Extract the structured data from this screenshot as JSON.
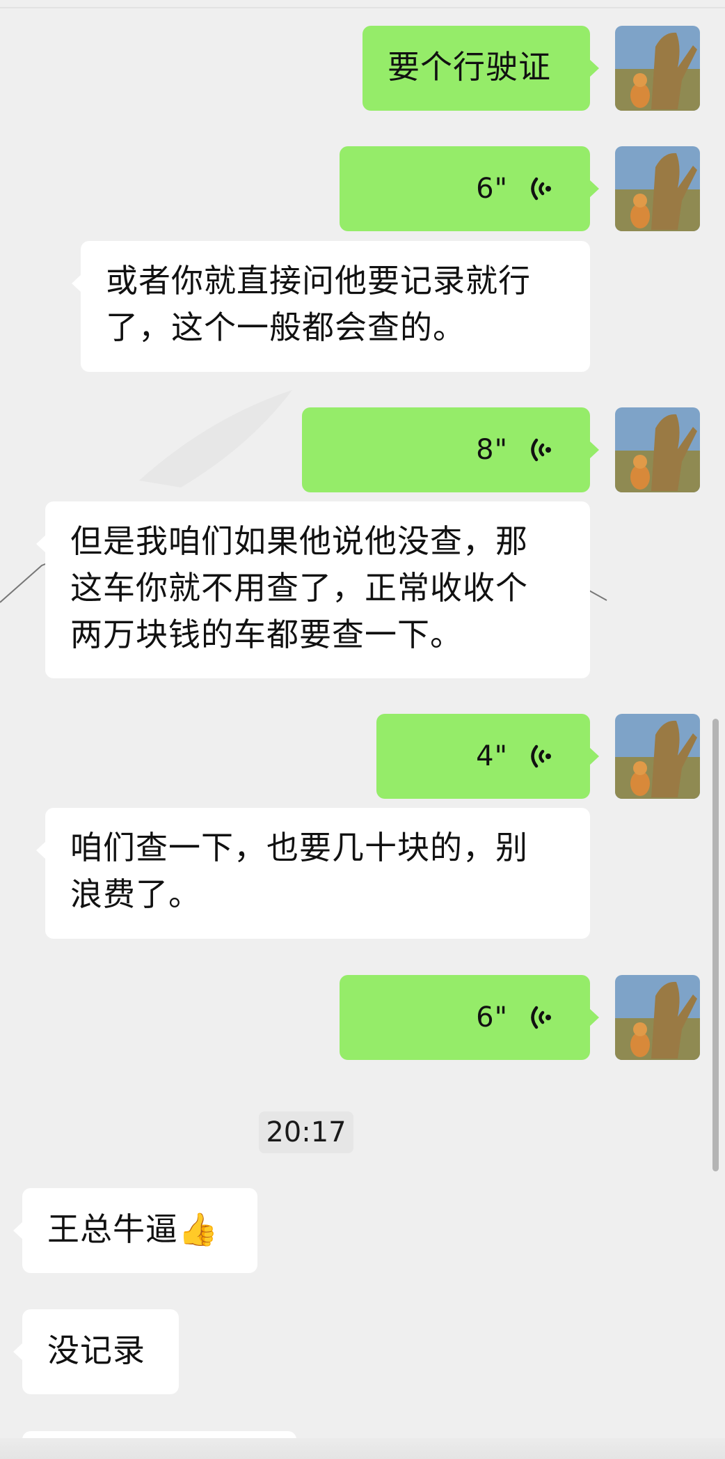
{
  "messages": [
    {
      "kind": "text",
      "side": "sent",
      "text": "要个行驶证"
    },
    {
      "kind": "voice",
      "side": "sent",
      "duration": "6\""
    },
    {
      "kind": "text",
      "side": "received",
      "lines": [
        "或者你就直接问他要记录就行",
        "了，这个一般都会查的。"
      ]
    },
    {
      "kind": "voice",
      "side": "sent",
      "duration": "8\""
    },
    {
      "kind": "text",
      "side": "received",
      "lines": [
        "但是我咱们如果他说他没查，那",
        "这车你就不用查了，正常收收个",
        "两万块钱的车都要查一下。"
      ]
    },
    {
      "kind": "voice",
      "side": "sent",
      "duration": "4\""
    },
    {
      "kind": "text",
      "side": "received",
      "lines": [
        "咱们查一下，也要几十块的，别",
        "浪费了。"
      ]
    },
    {
      "kind": "voice",
      "side": "sent",
      "duration": "6\""
    },
    {
      "kind": "timestamp",
      "text": "20:17"
    },
    {
      "kind": "text",
      "side": "received",
      "text": "王总牛逼👍"
    },
    {
      "kind": "text",
      "side": "received",
      "text": "没记录"
    }
  ],
  "icons": {
    "voice": "voice-wave-icon",
    "avatar": "avatar-dinosaur-dog-photo",
    "emoji": "thumbs-up-emoji"
  },
  "colors": {
    "background": "#efefef",
    "sent_bubble": "#95ec69",
    "received_bubble": "#ffffff",
    "text": "#111111"
  }
}
